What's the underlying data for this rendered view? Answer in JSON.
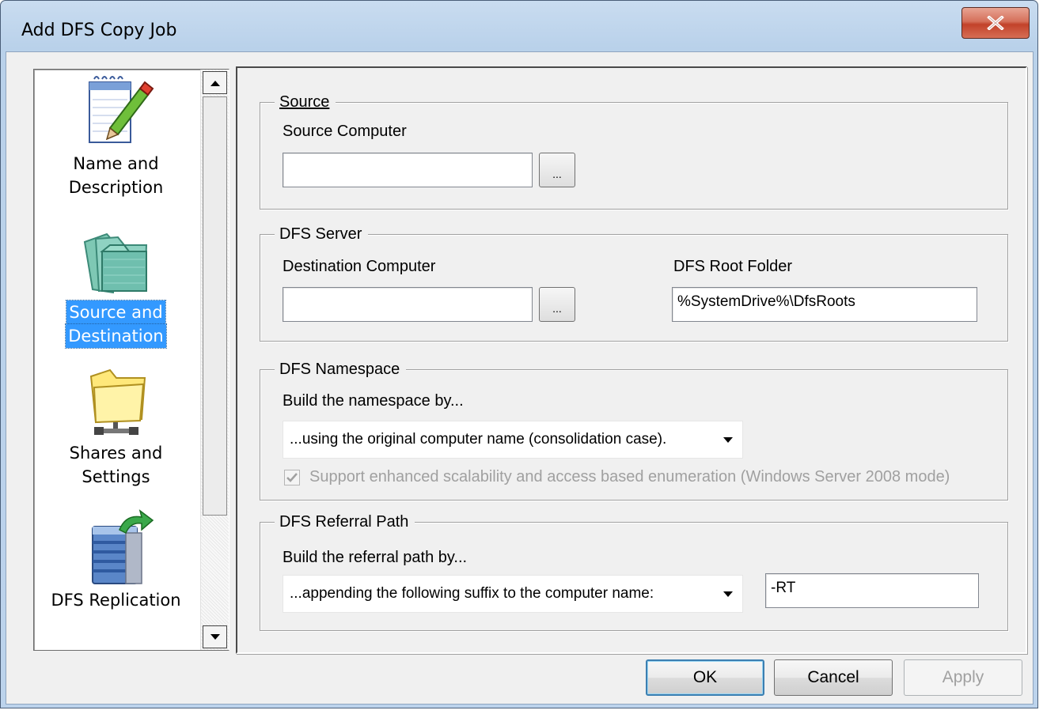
{
  "window": {
    "title": "Add DFS Copy Job",
    "close_icon": "close-x-icon"
  },
  "nav": {
    "items": [
      {
        "label_line1": "Name and",
        "label_line2": "Description",
        "icon": "notepad-pencil-icon",
        "selected": false
      },
      {
        "label_line1": "Source and",
        "label_line2": "Destination",
        "icon": "folders-icon",
        "selected": true
      },
      {
        "label_line1": "Shares and",
        "label_line2": "Settings",
        "icon": "shared-folder-icon",
        "selected": false
      },
      {
        "label_line1": "DFS Replication",
        "label_line2": "",
        "icon": "replication-server-icon",
        "selected": false
      }
    ]
  },
  "source": {
    "legend": "Source",
    "computer_label": "Source Computer",
    "computer_value": "",
    "browse_label": "..."
  },
  "dfs_server": {
    "legend": "DFS Server",
    "dest_label": "Destination Computer",
    "dest_value": "",
    "browse_label": "...",
    "root_label": "DFS Root Folder",
    "root_value": "%SystemDrive%\\DfsRoots"
  },
  "namespace": {
    "legend": "DFS Namespace",
    "build_label": "Build the namespace by...",
    "selected_option": "...using the original computer name (consolidation case).",
    "checkbox_label": "Support enhanced scalability and access based enumeration (Windows Server 2008 mode)",
    "checkbox_checked": true,
    "checkbox_enabled": false
  },
  "referral": {
    "legend": "DFS Referral Path",
    "build_label": "Build the referral path by...",
    "selected_option": "...appending the following suffix to the computer name:",
    "suffix_value": "-RT"
  },
  "buttons": {
    "ok": "OK",
    "cancel": "Cancel",
    "apply": "Apply"
  },
  "colors": {
    "selection": "#3399ff",
    "close_button": "#c7452d",
    "title_bar": "#b9d1ea"
  }
}
